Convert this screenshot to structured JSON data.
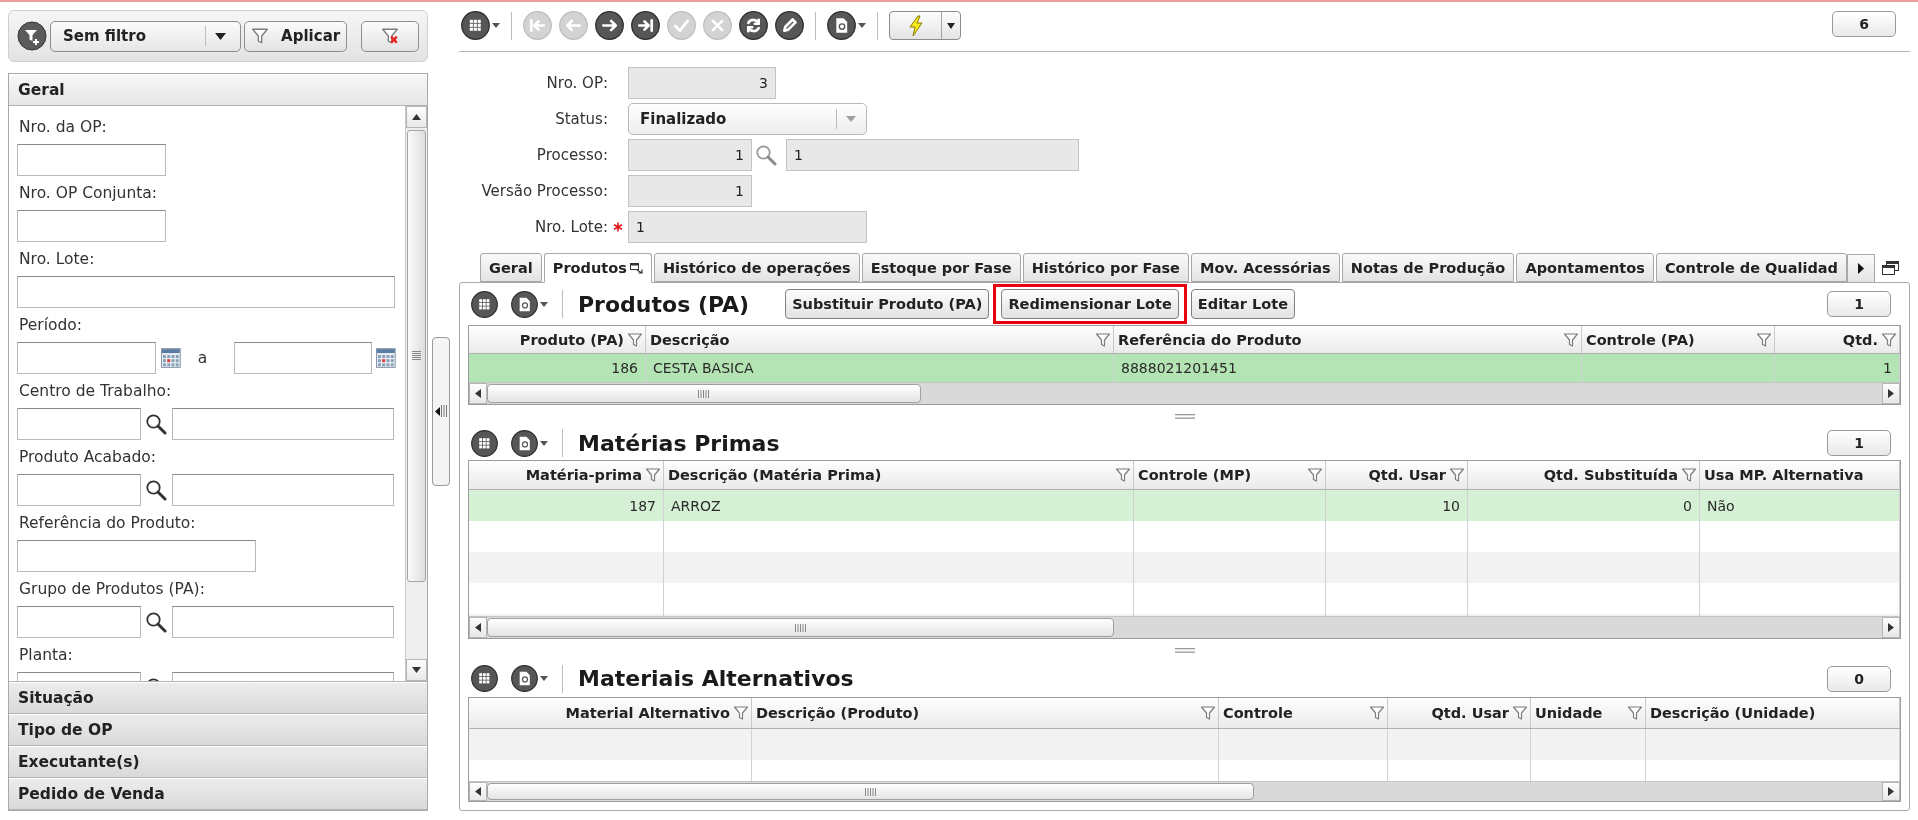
{
  "filter_bar": {
    "selected_filter": "Sem filtro",
    "apply_button": "Aplicar"
  },
  "filter_panel": [
    {
      "title": "Geral",
      "expanded": true,
      "fields": [
        {
          "label": "Nro. da OP:",
          "kind": "short"
        },
        {
          "label": "Nro. OP Conjunta:",
          "kind": "short"
        },
        {
          "label": "Nro. Lote:",
          "kind": "wide"
        },
        {
          "label": "Período:",
          "kind": "date_range",
          "separator": "a"
        },
        {
          "label": "Centro de Trabalho:",
          "kind": "lookup"
        },
        {
          "label": "Produto Acabado:",
          "kind": "lookup"
        },
        {
          "label": "Referência do Produto:",
          "kind": "medium"
        },
        {
          "label": "Grupo de Produtos (PA):",
          "kind": "lookup"
        },
        {
          "label": "Planta:",
          "kind": "lookup"
        }
      ]
    },
    {
      "title": "Situação",
      "expanded": false
    },
    {
      "title": "Tipo de OP",
      "expanded": false
    },
    {
      "title": "Executante(s)",
      "expanded": false
    },
    {
      "title": "Pedido de Venda",
      "expanded": false
    }
  ],
  "toolbar": [
    {
      "kind": "grid_menu",
      "disabled": false
    },
    {
      "kind": "separator"
    },
    {
      "kind": "first",
      "disabled": true
    },
    {
      "kind": "previous",
      "disabled": true
    },
    {
      "kind": "next",
      "disabled": false
    },
    {
      "kind": "last",
      "disabled": false
    },
    {
      "kind": "confirm",
      "disabled": true
    },
    {
      "kind": "cancel",
      "disabled": true
    },
    {
      "kind": "refresh",
      "disabled": false
    },
    {
      "kind": "edit",
      "disabled": false
    },
    {
      "kind": "separator"
    },
    {
      "kind": "document_menu",
      "disabled": false
    },
    {
      "kind": "separator"
    },
    {
      "kind": "action_menu",
      "disabled": false
    }
  ],
  "record_count": "6",
  "record": [
    {
      "label": "Nro. OP:",
      "kind": "number",
      "value": "3",
      "required": false
    },
    {
      "label": "Status:",
      "kind": "select",
      "value": "Finalizado",
      "required": false
    },
    {
      "label": "Processo:",
      "kind": "lookup",
      "value": "1",
      "description": "1",
      "required": false
    },
    {
      "label": "Versão Processo:",
      "kind": "number",
      "value": "1",
      "required": false
    },
    {
      "label": "Nro. Lote:",
      "kind": "text",
      "value": "1",
      "required": true
    }
  ],
  "tabs": [
    {
      "label": "Geral",
      "selected": false
    },
    {
      "label": "Produtos",
      "selected": true
    },
    {
      "label": "Histórico de operações",
      "selected": false
    },
    {
      "label": "Estoque por Fase",
      "selected": false
    },
    {
      "label": "Histórico por Fase",
      "selected": false
    },
    {
      "label": "Mov. Acessórias",
      "selected": false
    },
    {
      "label": "Notas de Produção",
      "selected": false
    },
    {
      "label": "Apontamentos",
      "selected": false
    },
    {
      "label": "Controle de Qualidad",
      "selected": false
    }
  ],
  "grids": [
    {
      "title": "Produtos (PA)",
      "count": "1",
      "active": true,
      "buttons": [
        {
          "label": "Substituir Produto (PA)",
          "highlighted": false
        },
        {
          "label": "Redimensionar Lote",
          "highlighted": true
        },
        {
          "label": "Editar Lote",
          "highlighted": false
        }
      ],
      "columns": [
        {
          "label": "Produto (PA)",
          "right_aligned": true,
          "filter": true
        },
        {
          "label": "Descrição",
          "right_aligned": false,
          "filter": true
        },
        {
          "label": "Referência do Produto",
          "right_aligned": false,
          "filter": true
        },
        {
          "label": "Controle (PA)",
          "right_aligned": false,
          "filter": true
        },
        {
          "label": "Qtd.",
          "right_aligned": true,
          "filter": true
        }
      ],
      "rows": [
        {
          "selected": true,
          "cells": [
            "186",
            "CESTA BASICA",
            "8888021201451",
            null,
            "1"
          ]
        }
      ]
    },
    {
      "title": "Matérias Primas",
      "count": "1",
      "active": false,
      "columns": [
        {
          "label": "Matéria-prima",
          "right_aligned": true,
          "filter": true
        },
        {
          "label": "Descrição (Matéria Prima)",
          "right_aligned": false,
          "filter": true
        },
        {
          "label": "Controle (MP)",
          "right_aligned": false,
          "filter": true
        },
        {
          "label": "Qtd. Usar",
          "right_aligned": true,
          "filter": true
        },
        {
          "label": "Qtd. Substituída",
          "right_aligned": true,
          "filter": true
        },
        {
          "label": "Usa MP. Alternativa",
          "right_aligned": false,
          "filter": false
        }
      ],
      "rows": [
        {
          "selected": true,
          "cells": [
            "187",
            "ARROZ",
            null,
            "10",
            "0",
            "Não"
          ]
        }
      ]
    },
    {
      "title": "Materiais Alternativos",
      "count": "0",
      "columns": [
        {
          "label": "Material Alternativo",
          "right_aligned": true,
          "filter": true
        },
        {
          "label": "Descrição (Produto)",
          "right_aligned": false,
          "filter": true
        },
        {
          "label": "Controle",
          "right_aligned": false,
          "filter": true
        },
        {
          "label": "Qtd. Usar",
          "right_aligned": true,
          "filter": true
        },
        {
          "label": "Unidade",
          "right_aligned": false,
          "filter": true
        },
        {
          "label": "Descrição (Unidade)",
          "right_aligned": false,
          "filter": false
        }
      ]
    }
  ]
}
